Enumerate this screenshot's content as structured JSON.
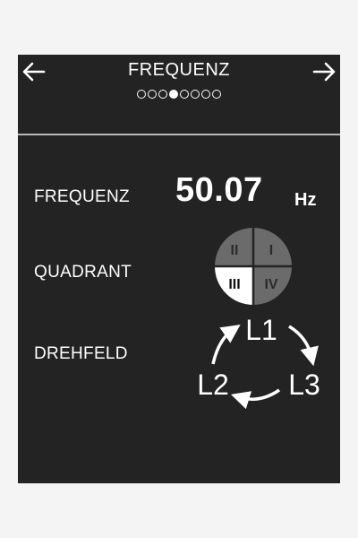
{
  "header": {
    "title": "FREQUENZ",
    "page_count": 8,
    "active_page": 4
  },
  "rows": {
    "frequency": {
      "label": "FREQUENZ",
      "value": "50.07",
      "unit": "Hz"
    },
    "quadrant": {
      "label": "QUADRANT",
      "quadrants": [
        "I",
        "II",
        "III",
        "IV"
      ],
      "active": "III"
    },
    "rotation": {
      "label": "DREHFELD",
      "phases": [
        "L1",
        "L2",
        "L3"
      ]
    }
  },
  "colors": {
    "background": "#232323",
    "text": "#ffffff",
    "quadrant_inactive": "#6b6b6b",
    "quadrant_active": "#ffffff"
  }
}
